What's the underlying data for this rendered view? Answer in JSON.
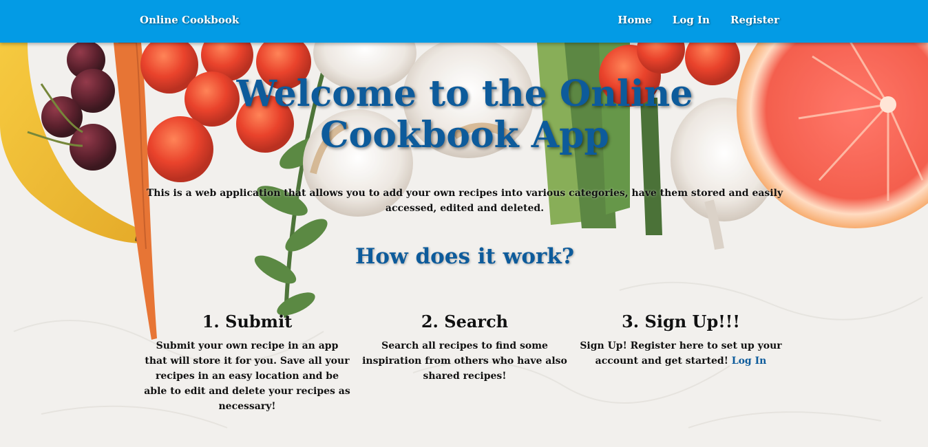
{
  "navbar": {
    "brand": "Online Cookbook",
    "links": [
      "Home",
      "Log In",
      "Register"
    ]
  },
  "hero": {
    "title": "Welcome to the Online Cookbook App",
    "description": "This is a web application that allows you to add your own recipes into various categories, have them stored and easily accessed, edited and deleted.",
    "subtitle": "How does it work?"
  },
  "steps": [
    {
      "heading": "1. Submit",
      "text": "Submit your own recipe in an app that will store it for you. Save all your recipes in an easy location and be able to edit and delete your recipes as necessary!"
    },
    {
      "heading": "2. Search",
      "text": "Search all recipes to find some inspiration from others who have also shared recipes!"
    },
    {
      "heading": "3. Sign Up!!!",
      "text": "Sign Up! Register here to set up your account and get started!",
      "link": "Log In"
    }
  ],
  "colors": {
    "navbar": "#039be5",
    "heading_blue": "#0d5b9b"
  }
}
